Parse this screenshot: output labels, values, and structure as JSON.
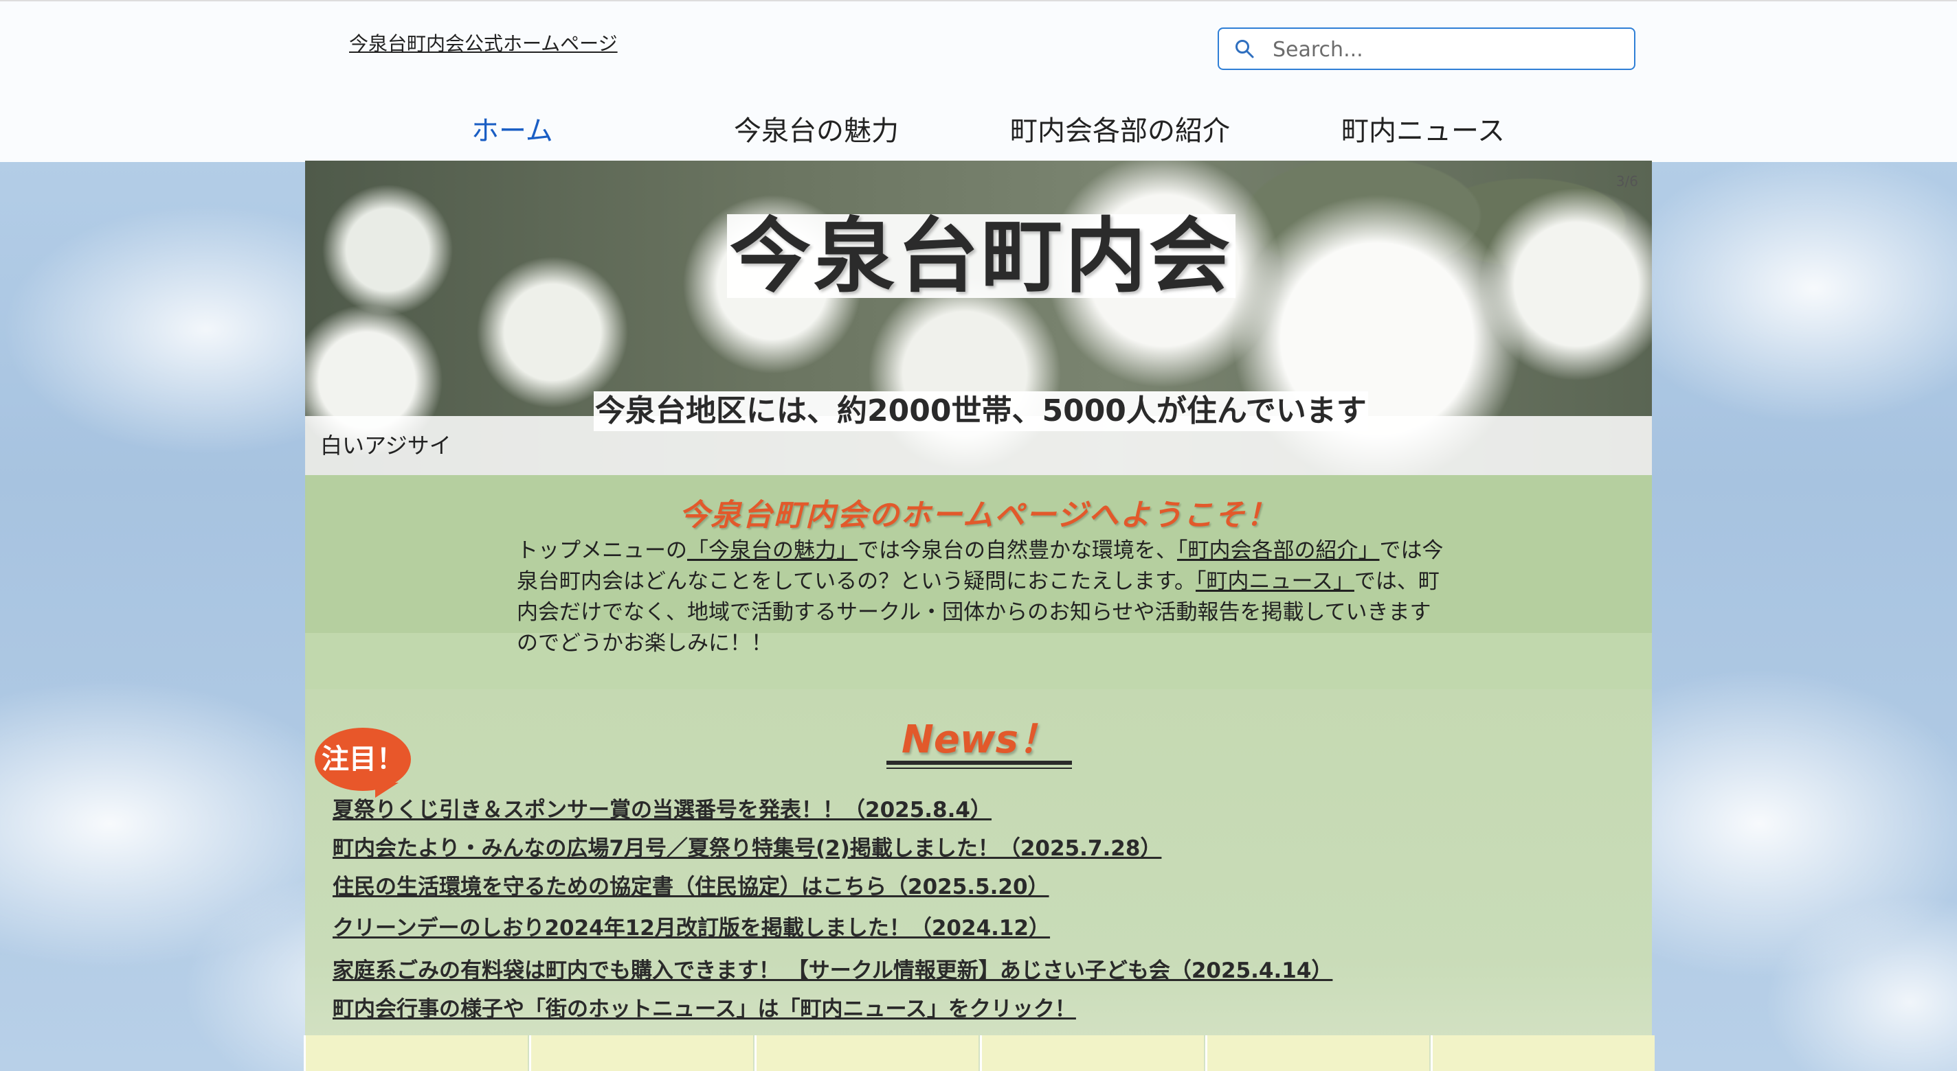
{
  "header": {
    "site_title": "今泉台町内会公式ホームページ",
    "search_placeholder": "Search..."
  },
  "nav": {
    "items": [
      {
        "label": "ホーム",
        "active": true
      },
      {
        "label": "今泉台の魅力",
        "active": false
      },
      {
        "label": "町内会各部の紹介",
        "active": false
      },
      {
        "label": "町内ニュース",
        "active": false
      }
    ]
  },
  "hero": {
    "counter": "3/6",
    "title": "今泉台町内会",
    "subtitle": "今泉台地区には、約2000世帯、5000人が住んでいます",
    "caption": "白いアジサイ"
  },
  "welcome": {
    "title": "今泉台町内会のホームページへようこそ！",
    "body": {
      "p1": "トップメニューの",
      "link1": "「今泉台の魅力」",
      "p2": "では今泉台の自然豊かな環境を、",
      "link2": "「町内会各部の紹介」",
      "p3": "では今泉台町内会はどんなことをしているの？という疑問におこたえします。",
      "link3": "「町内ニュース」",
      "p4": "では、町内会だけでなく、地域で活動するサークル・団体からのお知らせや活動報告を掲載していきますのでどうかお楽しみに！！"
    }
  },
  "news": {
    "title": "News！",
    "badge": "注目！",
    "items": [
      "夏祭りくじ引き＆スポンサー賞の当選番号を発表！！（2025.8.4）",
      "町内会たより・みんなの広場7月号／夏祭り特集号(2)掲載しました！（2025.7.28）",
      "住民の生活環境を守るための協定書（住民協定）はこちら（2025.5.20）",
      "クリーンデーのしおり2024年12月改訂版を掲載しました！（2024.12）",
      "家庭系ごみの有料袋は町内でも購入できます！ 【サークル情報更新】あじさい子ども会（2025.4.14）",
      "町内会行事の様子や「街のホットニュース」は「町内ニュース」をクリック！"
    ]
  },
  "colors": {
    "accent_orange": "#e2592b",
    "nav_active": "#1a5ec4",
    "search_border": "#2f7fd6",
    "welcome_bg": "#b5cf9f",
    "news_bg": "#c5d9b2"
  },
  "icons": {
    "search": "search-icon"
  }
}
